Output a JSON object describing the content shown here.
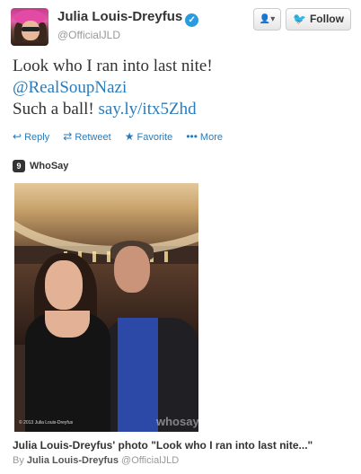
{
  "header": {
    "display_name": "Julia Louis-Dreyfus",
    "handle": "@OfficialJLD",
    "follow_label": "Follow"
  },
  "tweet": {
    "line1": "Look who I ran into last nite!",
    "mention": "@RealSoupNazi",
    "line3_text": "Such a ball!",
    "link": "say.ly/itx5Zhd"
  },
  "actions": {
    "reply": "Reply",
    "retweet": "Retweet",
    "favorite": "Favorite",
    "more": "More"
  },
  "media": {
    "provider": "WhoSay",
    "photo_copyright": "© 2013 Julia Louis-Dreyfus",
    "watermark": "whosay",
    "title": "Julia Louis-Dreyfus' photo \"Look who I ran into last nite...\"",
    "by_prefix": "By",
    "by_name": "Julia Louis-Dreyfus",
    "by_handle": "@OfficialJLD"
  },
  "colors": {
    "link": "#2b7bb9",
    "verified": "#2b9be0"
  },
  "icons": [
    "verified-icon",
    "user-menu-icon",
    "twitter-bird-icon",
    "reply-icon",
    "retweet-icon",
    "favorite-icon",
    "more-icon",
    "whosay-logo-icon"
  ]
}
